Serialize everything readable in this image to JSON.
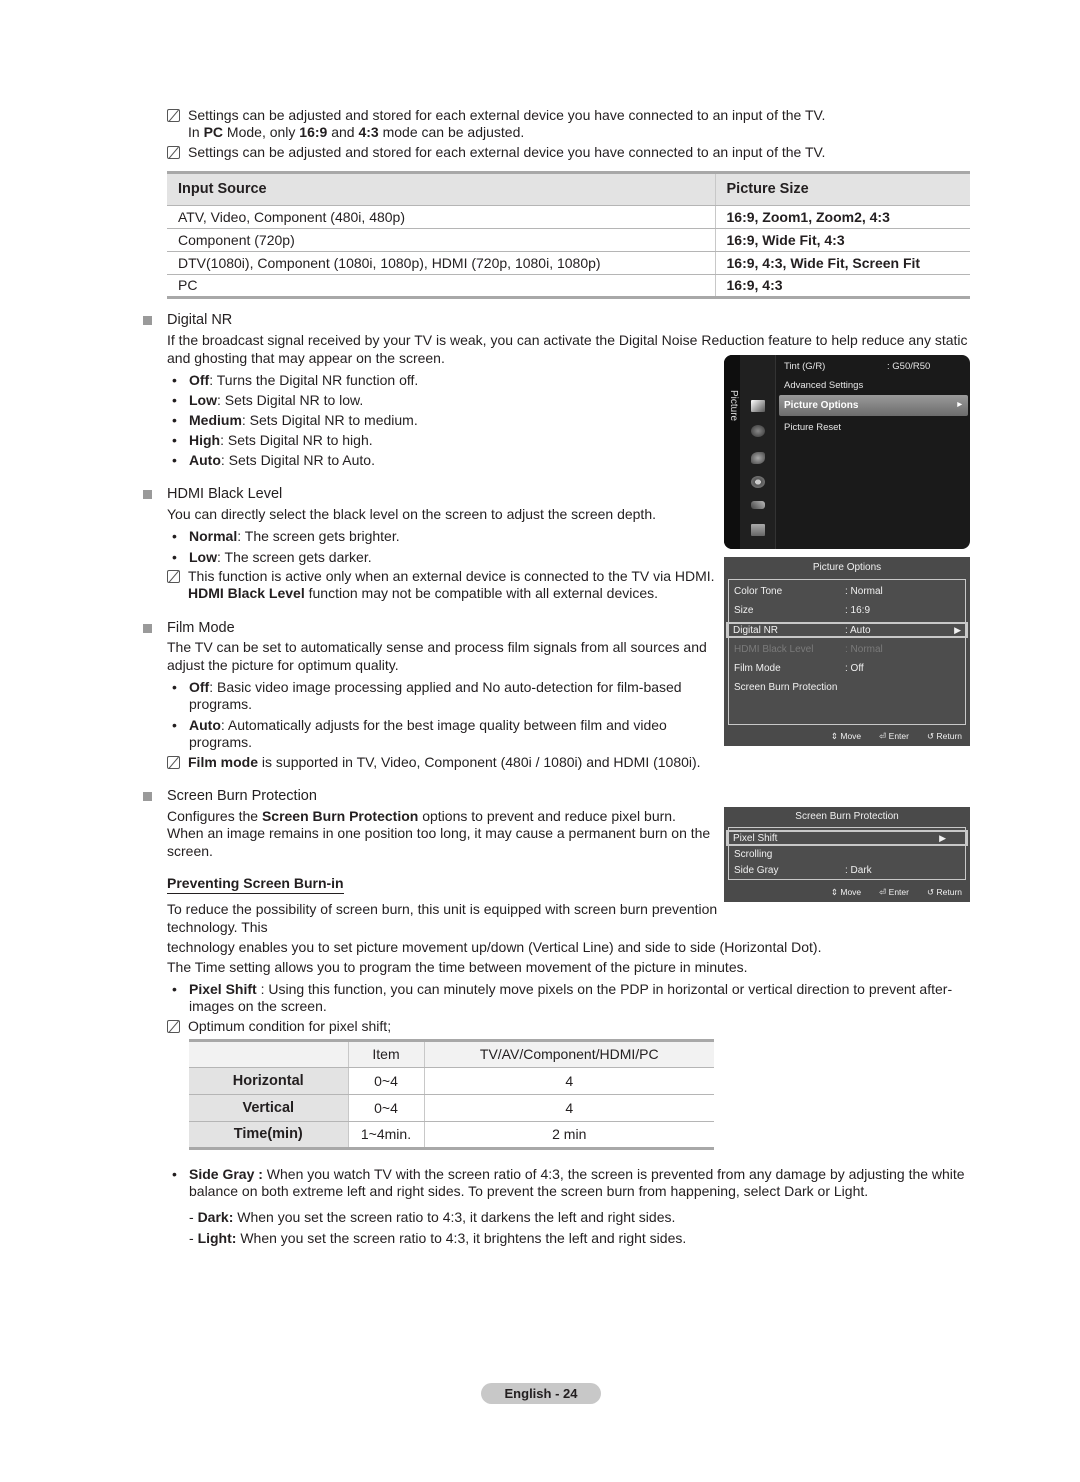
{
  "notes_top": [
    {
      "text": "Settings can be adjusted and stored for each external device you have connected to an input of the TV.",
      "line2_prefix": "In ",
      "line2_b1": "PC",
      "line2_mid1": " Mode, only ",
      "line2_b2": "16:9",
      "line2_mid2": " and ",
      "line2_b3": "4:3",
      "line2_suffix": " mode can be adjusted."
    },
    {
      "text": "Settings can be adjusted and stored for each external device you have connected to an input of the TV."
    }
  ],
  "picture_size_table": {
    "headers": [
      "Input Source",
      "Picture Size"
    ],
    "rows": [
      [
        "ATV, Video, Component (480i, 480p)",
        "16:9, Zoom1, Zoom2, 4:3"
      ],
      [
        "Component (720p)",
        "16:9, Wide Fit, 4:3"
      ],
      [
        "DTV(1080i), Component (1080i, 1080p), HDMI (720p, 1080i, 1080p)",
        "16:9, 4:3, Wide Fit, Screen Fit"
      ],
      [
        "PC",
        "16:9, 4:3"
      ]
    ]
  },
  "digital_nr": {
    "title": "Digital NR",
    "desc1": "If the broadcast signal received by your TV is weak, you can activate the Digital Noise Reduction feature to help reduce any static",
    "desc2": "and ghosting that may appear on the screen.",
    "bullets": [
      {
        "term": "Off",
        "text": ": Turns the Digital NR function off."
      },
      {
        "term": "Low",
        "text": ": Sets Digital NR to low."
      },
      {
        "term": "Medium",
        "text": ": Sets Digital NR to medium."
      },
      {
        "term": "High",
        "text": ": Sets Digital NR to high."
      },
      {
        "term": "Auto",
        "text": ": Sets Digital NR to Auto."
      }
    ]
  },
  "hdmi_black": {
    "title": "HDMI Black Level",
    "desc": "You can directly select the black level on the screen to adjust the screen depth.",
    "bullets": [
      {
        "term": "Normal",
        "text": ": The screen gets brighter."
      },
      {
        "term": "Low",
        "text": ": The screen gets darker."
      }
    ],
    "note1": "This function is active only when an external device is connected to the TV via HDMI.",
    "note2_b": "HDMI Black Level",
    "note2": " function may not be compatible with all external devices."
  },
  "film_mode": {
    "title": "Film Mode",
    "desc1": "The TV can be set to automatically sense and process film signals from all sources and",
    "desc2": "adjust the picture for optimum quality.",
    "bullets": [
      {
        "term": "Off",
        "text": ": Basic video image processing applied and No auto-detection for film-based",
        "cont": "programs."
      },
      {
        "term": "Auto",
        "text": ": Automatically adjusts for the best image quality between film and video",
        "cont": "programs."
      }
    ],
    "note_b": "Film mode",
    "note": " is supported in TV, Video, Component (480i / 1080i) and HDMI (1080i)."
  },
  "sbp": {
    "title": "Screen Burn Protection",
    "desc_pre": "Configures the ",
    "desc_b": "Screen Burn Protection",
    "desc_post": " options to prevent and reduce pixel burn.",
    "desc2": "When an image remains in one position too long, it may cause a permanent burn on the",
    "desc3": "screen.",
    "subhead": "Preventing Screen Burn-in",
    "p1": "To reduce the possibility of screen burn, this unit is equipped with screen burn prevention",
    "p1b": "technology. This",
    "p2": "technology enables you to set picture movement up/down (Vertical Line) and side to side (Horizontal Dot).",
    "p3": "The Time setting allows you to program the time between movement of the picture in minutes.",
    "pixel_shift_term": "Pixel Shift",
    "pixel_shift_text": " : Using this function, you can minutely move pixels on the PDP in horizontal or vertical direction to prevent after-",
    "pixel_shift_cont": "images on the screen.",
    "note": "Optimum condition for pixel shift;",
    "side_gray_term": "Side Gray :",
    "side_gray_text": " When you watch TV with the screen ratio of 4:3, the screen is prevented from any damage by adjusting the white",
    "side_gray_cont": "balance on both extreme left and right sides. To prevent the screen burn from happening, select Dark or Light.",
    "dark_term": "Dark:",
    "dark_text": " When you set the screen ratio to 4:3, it darkens the left and right sides.",
    "light_term": "Light:",
    "light_text": " When you set the screen ratio to 4:3, it brightens the left and right sides."
  },
  "pixel_shift_table": {
    "headers": [
      "",
      "Item",
      "TV/AV/Component/HDMI/PC"
    ],
    "rows": [
      [
        "Horizontal",
        "0~4",
        "4"
      ],
      [
        "Vertical",
        "0~4",
        "4"
      ],
      [
        "Time(min)",
        "1~4min.",
        "2 min"
      ]
    ]
  },
  "picture_menu": {
    "tab_label": "Picture",
    "items": [
      {
        "label": "Tint (G/R)",
        "value": ": G50/R50"
      },
      {
        "label": "Advanced Settings",
        "value": ""
      },
      {
        "label": "Picture Options",
        "value": ""
      },
      {
        "label": "Picture Reset",
        "value": ""
      }
    ],
    "selected": "Picture Options"
  },
  "picture_options_panel": {
    "title": "Picture Options",
    "rows": [
      {
        "label": "Color Tone",
        "value": ": Normal"
      },
      {
        "label": "Size",
        "value": ": 16:9"
      },
      {
        "label": "Digital NR",
        "value": ": Auto"
      },
      {
        "label": "HDMI Black Level",
        "value": ": Normal"
      },
      {
        "label": "Film Mode",
        "value": ": Off"
      },
      {
        "label": "Screen Burn Protection",
        "value": ""
      }
    ],
    "footer": {
      "move": "Move",
      "enter": "Enter",
      "return": "Return"
    }
  },
  "sbp_panel": {
    "title": "Screen Burn Protection",
    "rows": [
      {
        "label": "Pixel Shift",
        "value": ""
      },
      {
        "label": "Scrolling",
        "value": ""
      },
      {
        "label": "Side Gray",
        "value": ": Dark"
      }
    ],
    "footer": {
      "move": "Move",
      "enter": "Enter",
      "return": "Return"
    }
  },
  "footer": {
    "page_label": "English - 24"
  }
}
